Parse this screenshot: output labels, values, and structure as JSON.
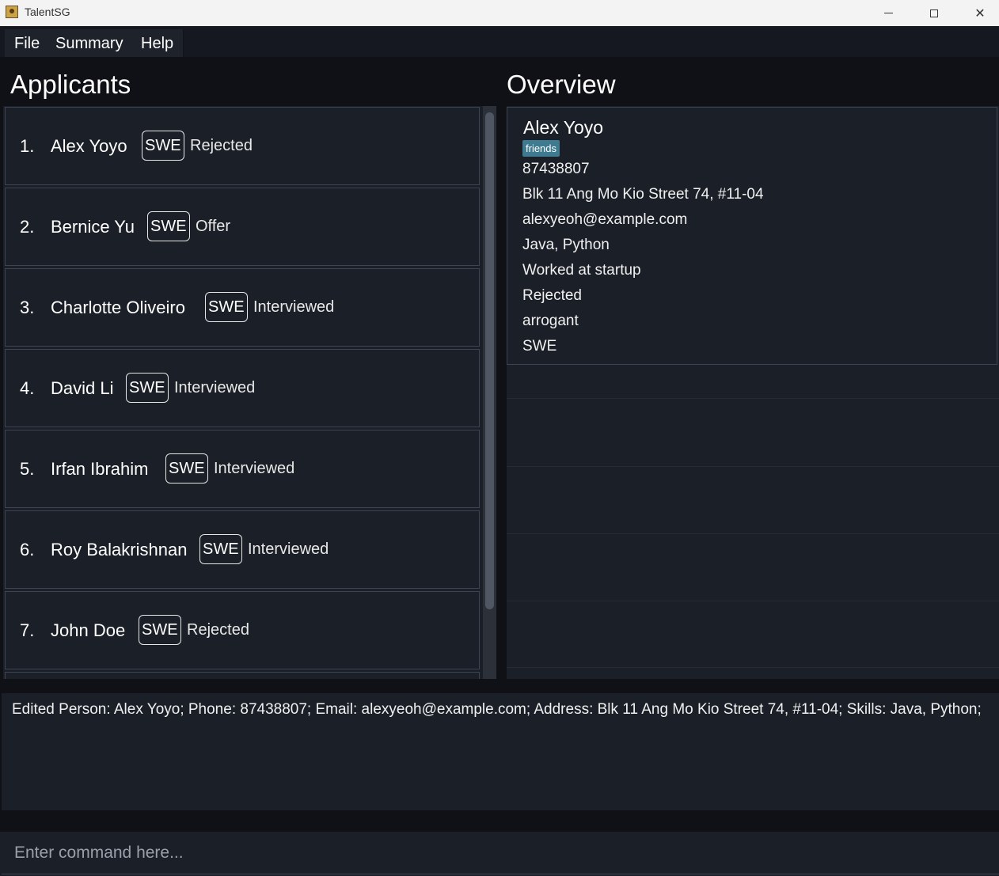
{
  "window": {
    "title": "TalentSG"
  },
  "menu": {
    "items": [
      "File",
      "Summary",
      "Help"
    ]
  },
  "applicants": {
    "title": "Applicants",
    "items": [
      {
        "index": "1.",
        "name": "Alex Yoyo",
        "tag": "SWE",
        "status": "Rejected"
      },
      {
        "index": "2.",
        "name": "Bernice Yu",
        "tag": "SWE",
        "status": "Offer"
      },
      {
        "index": "3.",
        "name": "Charlotte Oliveiro",
        "tag": "SWE",
        "status": "Interviewed"
      },
      {
        "index": "4.",
        "name": "David Li",
        "tag": "SWE",
        "status": "Interviewed"
      },
      {
        "index": "5.",
        "name": "Irfan Ibrahim",
        "tag": "SWE",
        "status": "Interviewed"
      },
      {
        "index": "6.",
        "name": "Roy Balakrishnan",
        "tag": "SWE",
        "status": "Interviewed"
      },
      {
        "index": "7.",
        "name": "John Doe",
        "tag": "SWE",
        "status": "Rejected"
      }
    ]
  },
  "overview": {
    "title": "Overview",
    "name": "Alex Yoyo",
    "tag": "friends",
    "phone": "87438807",
    "address": "Blk 11 Ang Mo Kio Street 74, #11-04",
    "email": "alexyeoh@example.com",
    "skills": "Java, Python",
    "experience": "Worked at startup",
    "status": "Rejected",
    "note": "arrogant",
    "role": "SWE"
  },
  "result": {
    "text": "Edited Person: Alex Yoyo; Phone: 87438807; Email: alexyeoh@example.com; Address: Blk 11 Ang Mo Kio Street 74, #11-04; Skills: Java, Python;"
  },
  "command": {
    "placeholder": "Enter command here..."
  }
}
